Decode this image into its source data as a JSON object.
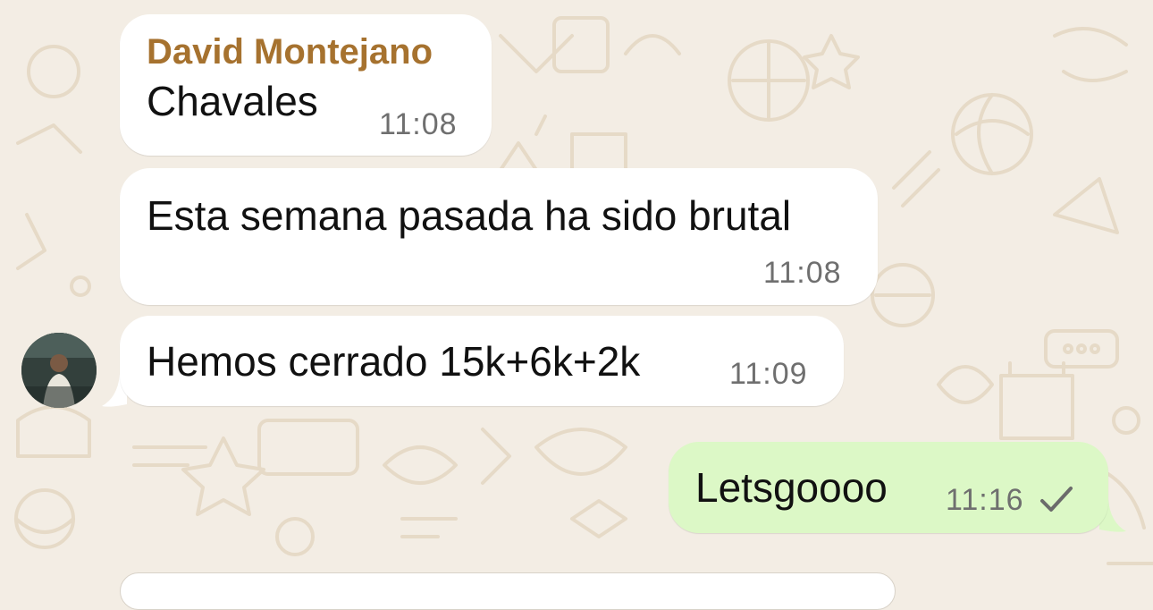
{
  "chat": {
    "messages": [
      {
        "sender": "David Montejano",
        "text": "Chavales",
        "time": "11:08"
      },
      {
        "text": "Esta semana pasada ha sido brutal",
        "time": "11:08"
      },
      {
        "text": "Hemos cerrado 15k+6k+2k",
        "time": "11:09"
      },
      {
        "text": "Letsgoooo",
        "time": "11:16",
        "status_icon": "single-check-icon"
      }
    ]
  },
  "colors": {
    "background": "#f3ede4",
    "incoming_bubble": "#ffffff",
    "outgoing_bubble": "#dcf8c6",
    "sender_name": "#a6722f",
    "timestamp": "#6f6f6f"
  }
}
